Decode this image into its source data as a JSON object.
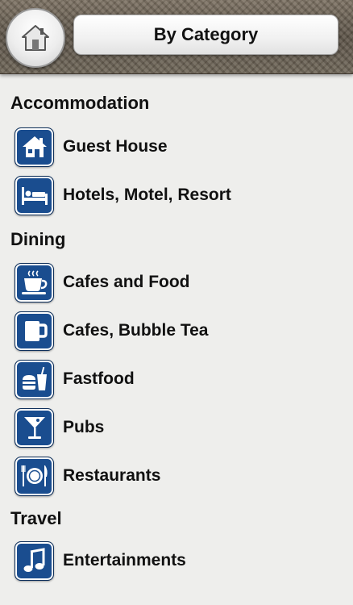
{
  "header": {
    "title": "By Category"
  },
  "sections": [
    {
      "title": "Accommodation",
      "items": [
        {
          "label": "Guest House",
          "icon": "house-icon"
        },
        {
          "label": "Hotels, Motel, Resort",
          "icon": "bed-icon"
        }
      ]
    },
    {
      "title": "Dining",
      "items": [
        {
          "label": "Cafes and Food",
          "icon": "coffee-cup-icon"
        },
        {
          "label": "Cafes, Bubble Tea",
          "icon": "mug-icon"
        },
        {
          "label": "Fastfood",
          "icon": "fastfood-icon"
        },
        {
          "label": "Pubs",
          "icon": "cocktail-icon"
        },
        {
          "label": "Restaurants",
          "icon": "plate-cutlery-icon"
        }
      ]
    },
    {
      "title": "Travel",
      "items": [
        {
          "label": "Entertainments",
          "icon": "music-note-icon"
        }
      ]
    }
  ],
  "colors": {
    "icon_background": "#1a4d8f",
    "page_background": "#eeeeec"
  }
}
